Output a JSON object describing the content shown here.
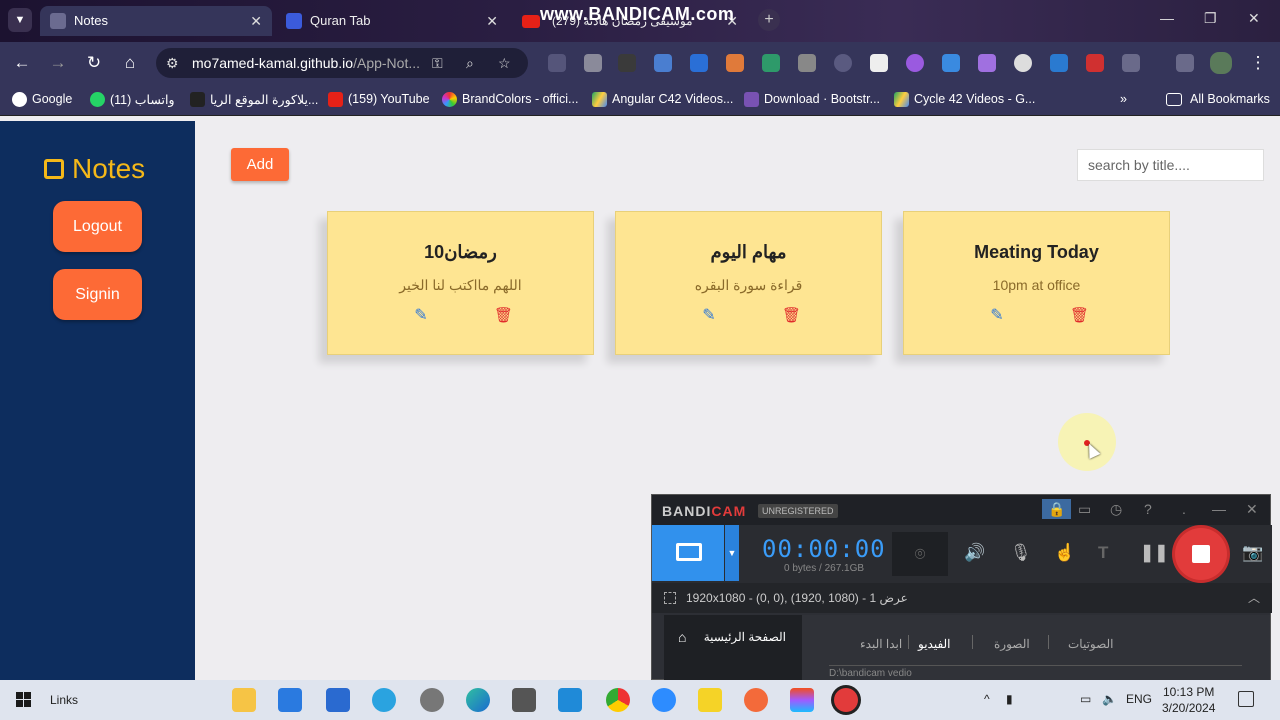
{
  "browser": {
    "tabs": [
      {
        "title": "Notes",
        "active": true
      },
      {
        "title": "Quran Tab",
        "active": false
      },
      {
        "title": "(279) موسيقى رمضان هادئة",
        "active": false
      }
    ],
    "watermark": "www.BANDICAM.com",
    "url_host": "mo7amed-kamal.github.io",
    "url_path": "/App-Not...",
    "bookmarks": [
      {
        "label": "Google"
      },
      {
        "label": "(11) واتساب"
      },
      {
        "label": "يلاكورة الموقع الريا..."
      },
      {
        "label": "(159) YouTube"
      },
      {
        "label": "BrandColors - offici..."
      },
      {
        "label": "Angular C42 Videos..."
      },
      {
        "label": "Download · Bootstr..."
      },
      {
        "label": "Cycle 42 Videos - G..."
      }
    ],
    "all_bookmarks": "All Bookmarks"
  },
  "sidebar": {
    "brand": "Notes",
    "logout": "Logout",
    "signin": "Signin"
  },
  "main": {
    "add_label": "Add",
    "search_placeholder": "search by title....",
    "notes": [
      {
        "title": "رمضان10",
        "body": "اللهم مااكتب لنا الخير"
      },
      {
        "title": "مهام اليوم",
        "body": "قراءة سورة البقره"
      },
      {
        "title": "Meating Today",
        "body": "10pm at office"
      }
    ]
  },
  "bandicam": {
    "logo_a": "BANDI",
    "logo_b": "CAM",
    "unregistered": "UNREGISTERED",
    "timer": "00:00:00",
    "bytes": "0 bytes / 267.1GB",
    "resolution": "1920x1080 - (0, 0), (1920, 1080) - عرض 1",
    "home": "الصفحة الرئيسية",
    "tabs": [
      "ابدا البدء",
      "الفيديو",
      "الصورة",
      "الصوتيات"
    ],
    "path": "D:\\bandicam vedio"
  },
  "taskbar": {
    "links": "Links",
    "lang": "ENG",
    "time": "10:13 PM",
    "date": "3/20/2024"
  }
}
